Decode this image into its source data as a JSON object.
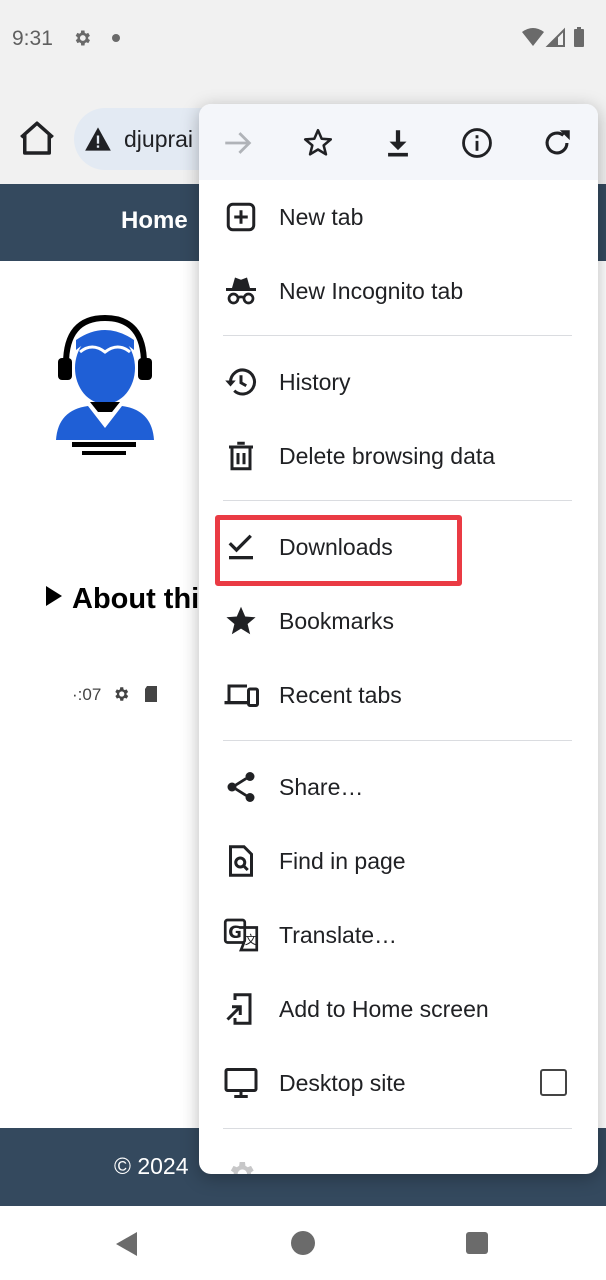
{
  "status_bar": {
    "time": "9:31"
  },
  "toolbar": {
    "url": "djuprai"
  },
  "page": {
    "nav_home": "Home",
    "about_heading": "About thi",
    "small_status": "·:07",
    "footer_text": "© 2024"
  },
  "menu": {
    "top_icons": [
      "forward-icon",
      "bookmark-star-icon",
      "download-icon",
      "info-icon",
      "reload-icon"
    ],
    "items": [
      {
        "label": "New tab",
        "icon": "new-tab-icon"
      },
      {
        "label": "New Incognito tab",
        "icon": "incognito-icon"
      },
      {
        "label": "History",
        "icon": "history-icon"
      },
      {
        "label": "Delete browsing data",
        "icon": "trash-icon"
      },
      {
        "label": "Downloads",
        "icon": "downloads-check-icon"
      },
      {
        "label": "Bookmarks",
        "icon": "star-icon"
      },
      {
        "label": "Recent tabs",
        "icon": "devices-icon"
      },
      {
        "label": "Share…",
        "icon": "share-icon"
      },
      {
        "label": "Find in page",
        "icon": "find-in-page-icon"
      },
      {
        "label": "Translate…",
        "icon": "translate-icon"
      },
      {
        "label": "Add to Home screen",
        "icon": "add-to-home-icon"
      },
      {
        "label": "Desktop site",
        "icon": "desktop-icon"
      }
    ]
  },
  "colors": {
    "page_header": "#34495e",
    "highlight": "#ea3b44",
    "avatar_blue": "#1f5fd6"
  }
}
